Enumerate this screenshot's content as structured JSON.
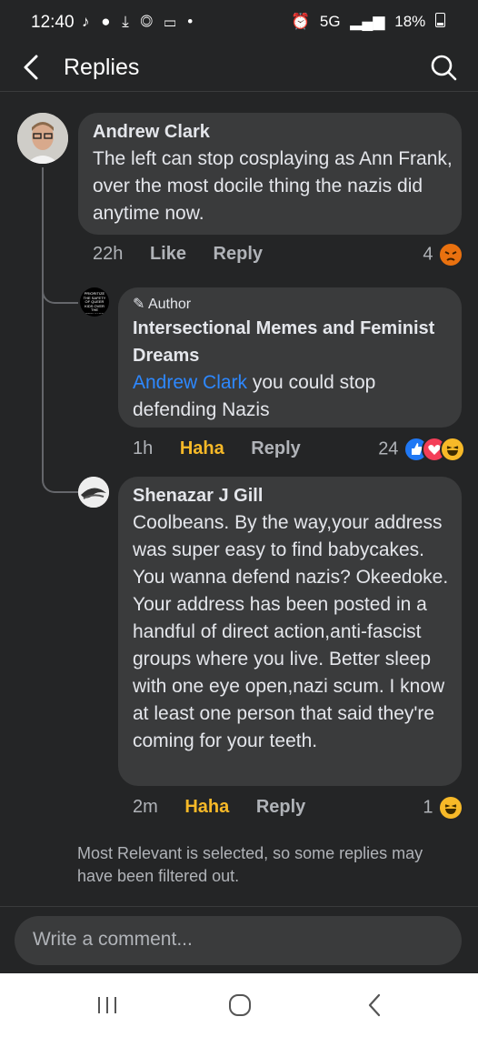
{
  "status": {
    "time": "12:40",
    "network": "5G",
    "battery": "18%"
  },
  "header": {
    "title": "Replies"
  },
  "comments": [
    {
      "author": "Andrew Clark",
      "text": "The left can stop cosplaying as Ann Frank, over the most docile thing the nazis did anytime now.",
      "time": "22h",
      "like_label": "Like",
      "reply_label": "Reply",
      "reaction_count": "4",
      "reactions": [
        "angry"
      ]
    },
    {
      "badge": "Author",
      "author": "Intersectional Memes and Feminist Dreams",
      "mention": "Andrew Clark",
      "text": " you could stop defending Nazis",
      "avatar_text": "PRIORITIZE THE SAFETY OF QUEER KIDS OVER THE FEELINGS OF ADULTS",
      "time": "1h",
      "like_label": "Haha",
      "reply_label": "Reply",
      "reaction_count": "24",
      "reactions": [
        "like",
        "love",
        "haha"
      ]
    },
    {
      "author": "Shenazar J Gill",
      "text": "Coolbeans. By the way,your address was super easy to find babycakes. You wanna defend nazis? Okeedoke. Your address has been posted in a handful of direct action,anti-fascist groups where you live. Better sleep with one eye open,nazi scum. I know at least one person that said they're coming for your teeth.",
      "time": "2m",
      "like_label": "Haha",
      "reply_label": "Reply",
      "reaction_count": "1",
      "reactions": [
        "haha"
      ]
    }
  ],
  "filter_note": "Most Relevant is selected, so some replies may have been filtered out.",
  "composer": {
    "placeholder": "Write a comment..."
  },
  "colors": {
    "background": "#242526",
    "bubble": "#3a3b3c",
    "mention": "#2d88ff",
    "haha": "#f7b928"
  }
}
